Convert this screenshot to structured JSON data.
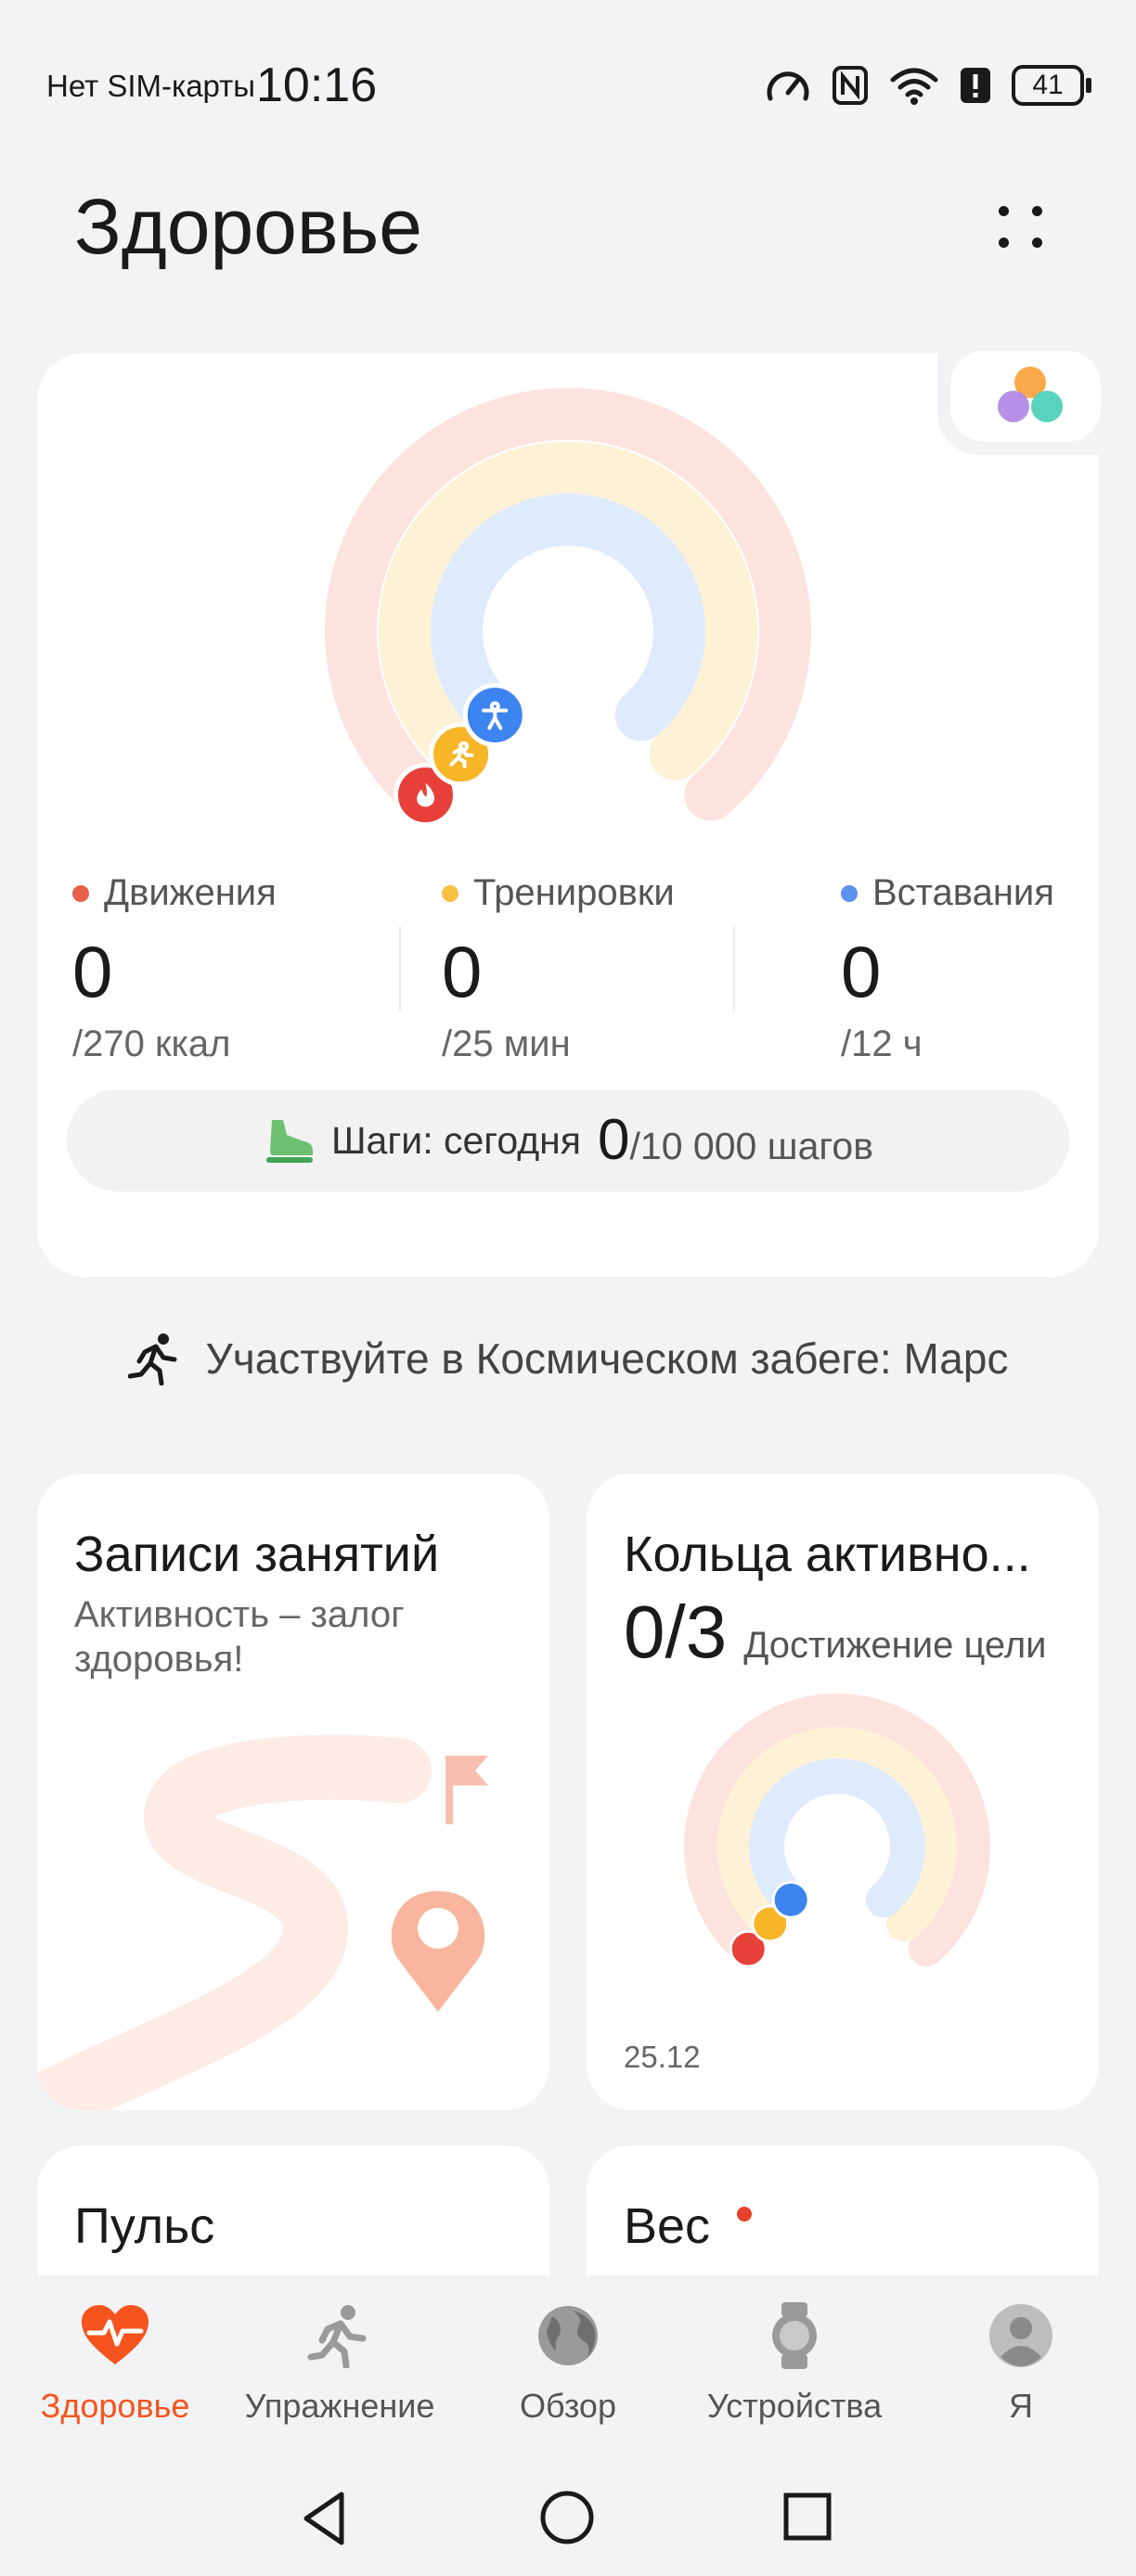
{
  "status_bar": {
    "carrier": "Нет SIM-карты",
    "time": "10:16",
    "battery": "41",
    "icons": [
      "speedometer-icon",
      "nfc-icon",
      "wifi-icon",
      "alert-icon",
      "battery-icon"
    ]
  },
  "header": {
    "title": "Здоровье",
    "menu_icon": "grid-dots-icon"
  },
  "activity": {
    "colors": {
      "move": "#e8403a",
      "exercise": "#f6b628",
      "stand": "#3c84f0"
    },
    "progress": {
      "move": 0,
      "exercise": 0,
      "stand": 0
    },
    "metrics": [
      {
        "label": "Движения",
        "value": "0",
        "goal": "/270 ккал"
      },
      {
        "label": "Тренировки",
        "value": "0",
        "goal": "/25 мин"
      },
      {
        "label": "Вставания",
        "value": "0",
        "goal": "/12 ч"
      }
    ],
    "steps": {
      "label": "Шаги: сегодня",
      "value": "0",
      "goal": "/10 000 шагов"
    }
  },
  "promo": {
    "text": "Участвуйте в Космическом забеге: Марс"
  },
  "tiles": {
    "records": {
      "title": "Записи занятий",
      "subtitle": "Активность – залог здоровья!"
    },
    "rings": {
      "title": "Кольца активно...",
      "value": "0/3",
      "subtitle": "Достижение цели",
      "date": "25.12"
    },
    "pulse": {
      "title": "Пульс"
    },
    "weight": {
      "title": "Вес"
    }
  },
  "bottom_nav": [
    {
      "label": "Здоровье",
      "icon": "heart-pulse-icon",
      "active": true
    },
    {
      "label": "Упражнение",
      "icon": "runner-icon",
      "active": false
    },
    {
      "label": "Обзор",
      "icon": "globe-icon",
      "active": false
    },
    {
      "label": "Устройства",
      "icon": "watch-icon",
      "active": false
    },
    {
      "label": "Я",
      "icon": "user-icon",
      "active": false
    }
  ]
}
